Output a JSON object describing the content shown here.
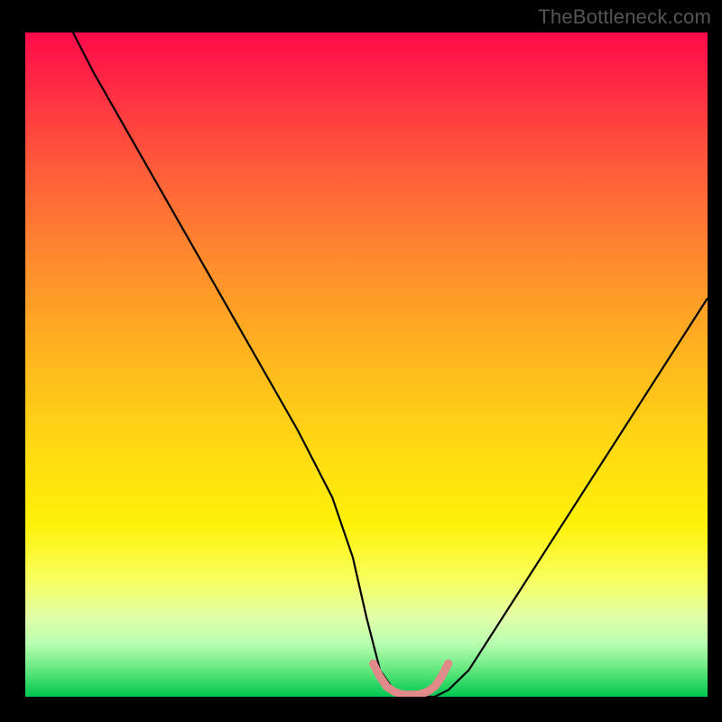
{
  "watermark": "TheBottleneck.com",
  "chart_data": {
    "type": "line",
    "title": "",
    "xlabel": "",
    "ylabel": "",
    "xlim": [
      0,
      100
    ],
    "ylim": [
      0,
      100
    ],
    "grid": false,
    "series": [
      {
        "name": "main-curve",
        "color": "#000000",
        "x": [
          7,
          10,
          15,
          20,
          25,
          30,
          35,
          40,
          45,
          48,
          50,
          52,
          54,
          56,
          58,
          60,
          62,
          65,
          70,
          75,
          80,
          85,
          90,
          95,
          100
        ],
        "y": [
          100,
          94,
          85,
          76,
          67,
          58,
          49,
          40,
          30,
          21,
          12,
          4,
          1,
          0,
          0,
          0,
          1,
          4,
          12,
          20,
          28,
          36,
          44,
          52,
          60
        ]
      },
      {
        "name": "minimum-highlight",
        "color": "#e08a8a",
        "x": [
          51,
          52,
          53,
          54,
          55,
          56,
          57,
          58,
          59,
          60,
          61,
          62
        ],
        "y": [
          5,
          3,
          1.5,
          0.8,
          0.4,
          0.3,
          0.3,
          0.4,
          0.8,
          1.5,
          3,
          5
        ]
      }
    ],
    "background_gradient": {
      "orientation": "vertical",
      "stops": [
        {
          "pos": 0.0,
          "color": "#ff0a4a"
        },
        {
          "pos": 0.5,
          "color": "#ffc81a"
        },
        {
          "pos": 0.8,
          "color": "#f8ff5a"
        },
        {
          "pos": 1.0,
          "color": "#00c850"
        }
      ]
    },
    "annotations": []
  }
}
